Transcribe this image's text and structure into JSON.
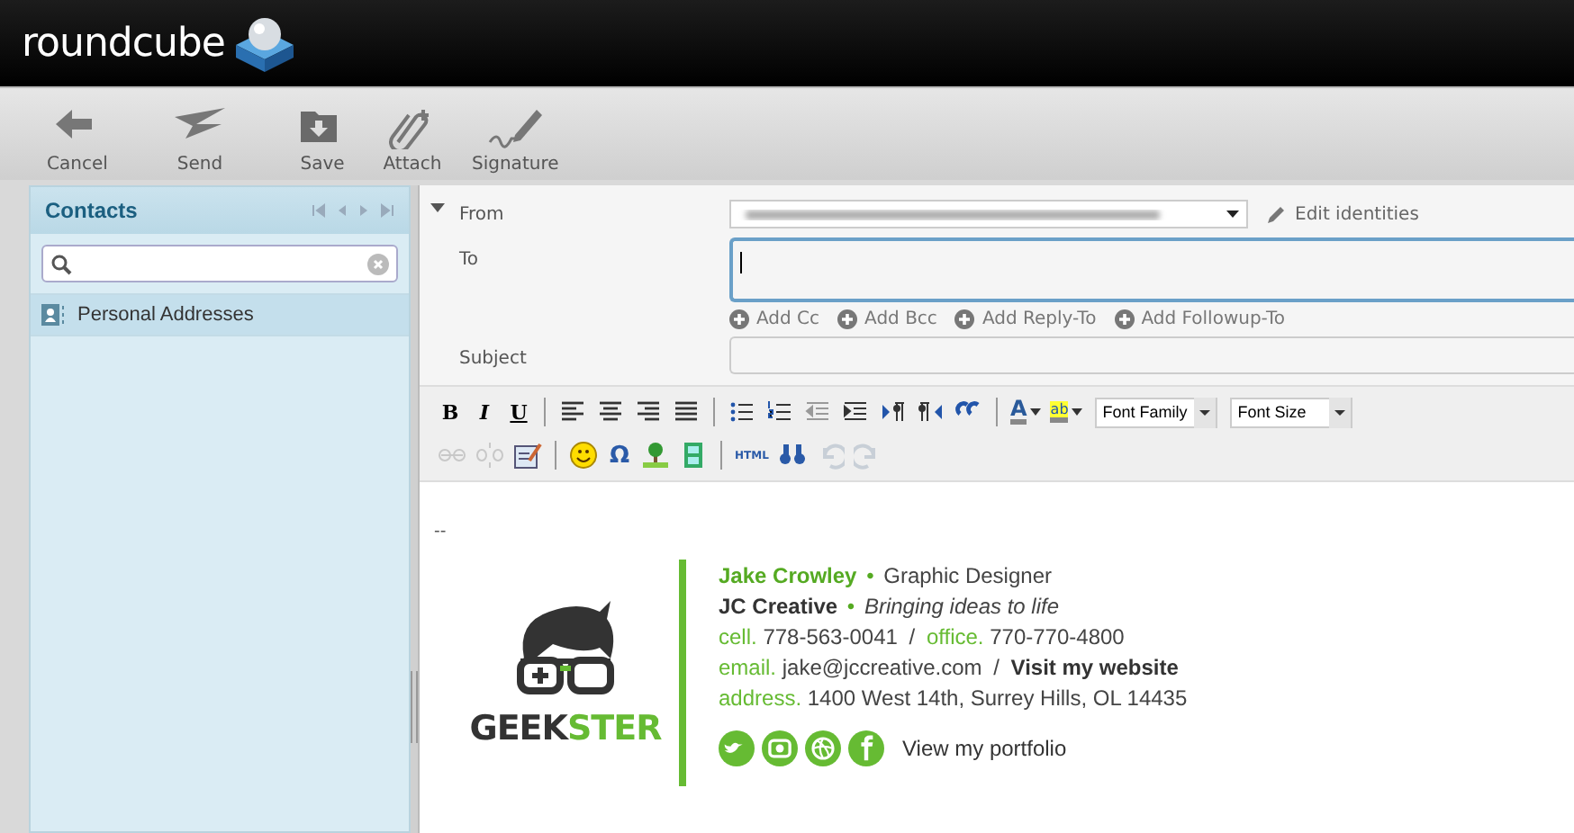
{
  "header": {
    "logo": "roundcube"
  },
  "toolbar": [
    {
      "kind": "cancel",
      "label": "Cancel"
    },
    {
      "kind": "send",
      "label": "Send"
    },
    {
      "kind": "save",
      "label": "Save"
    },
    {
      "kind": "attach",
      "label": "Attach"
    },
    {
      "kind": "signature",
      "label": "Signature"
    }
  ],
  "contacts": {
    "title": "Contacts",
    "address_books": [
      {
        "label": "Personal Addresses",
        "selected": true
      }
    ]
  },
  "compose": {
    "expanded": true,
    "from": {
      "label": "From"
    },
    "edit_identities": "Edit identities",
    "to": {
      "label": "To"
    },
    "add_links": [
      "Add Cc",
      "Add Bcc",
      "Add Reply-To",
      "Add Followup-To"
    ],
    "subject": {
      "label": "Subject"
    }
  },
  "editor": {
    "toolbar_rows": [
      [
        {
          "kind": "bold",
          "label": "B",
          "disabled": false
        },
        {
          "kind": "italic",
          "label": "I",
          "disabled": false
        },
        {
          "kind": "underline",
          "label": "U",
          "disabled": false
        },
        {
          "kind": "sep"
        },
        {
          "kind": "align-left",
          "disabled": false
        },
        {
          "kind": "align-center",
          "disabled": false
        },
        {
          "kind": "align-right",
          "disabled": false
        },
        {
          "kind": "justify",
          "disabled": false
        },
        {
          "kind": "sep"
        },
        {
          "kind": "bullets",
          "disabled": false
        },
        {
          "kind": "numbers",
          "disabled": false
        },
        {
          "kind": "outdent",
          "disabled": true
        },
        {
          "kind": "indent",
          "disabled": false
        },
        {
          "kind": "ltr",
          "disabled": false
        },
        {
          "kind": "rtl",
          "disabled": false
        },
        {
          "kind": "quote",
          "disabled": false
        },
        {
          "kind": "sep"
        },
        {
          "kind": "forecolor",
          "label": "A",
          "disabled": false
        },
        {
          "kind": "backcolor",
          "label": "ab",
          "disabled": false
        },
        {
          "kind": "select",
          "label": "Font Family"
        },
        {
          "kind": "select",
          "label": "Font Size"
        }
      ],
      [
        {
          "kind": "link",
          "disabled": true
        },
        {
          "kind": "unlink",
          "disabled": true
        },
        {
          "kind": "edit",
          "disabled": false
        },
        {
          "kind": "sep"
        },
        {
          "kind": "emoticon",
          "disabled": false
        },
        {
          "kind": "charmap",
          "label": "Ω",
          "disabled": false
        },
        {
          "kind": "image",
          "disabled": false
        },
        {
          "kind": "media",
          "disabled": false
        },
        {
          "kind": "sep"
        },
        {
          "kind": "html",
          "label": "HTML",
          "disabled": false
        },
        {
          "kind": "search",
          "disabled": false
        },
        {
          "kind": "undo",
          "disabled": true
        },
        {
          "kind": "redo",
          "disabled": true
        }
      ]
    ],
    "separator": "--",
    "signature": {
      "brand": [
        "GEEK",
        "STER"
      ],
      "lines": [
        [
          {
            "kind": "name",
            "text": "Jake Crowley"
          },
          {
            "kind": "dot",
            "text": "•"
          },
          {
            "kind": "text",
            "text": "Graphic Designer"
          }
        ],
        [
          {
            "kind": "bold",
            "text": "JC Creative"
          },
          {
            "kind": "dot",
            "text": "•"
          },
          {
            "kind": "italic",
            "text": "Bringing ideas to life"
          }
        ],
        [
          {
            "kind": "label",
            "text": "cell."
          },
          {
            "kind": "text",
            "text": "778-563-0041"
          },
          {
            "kind": "slash",
            "text": "/"
          },
          {
            "kind": "label",
            "text": "office."
          },
          {
            "kind": "text",
            "text": "770-770-4800"
          }
        ],
        [
          {
            "kind": "label",
            "text": "email."
          },
          {
            "kind": "text",
            "text": "jake@jccreative.com"
          },
          {
            "kind": "slash",
            "text": "/"
          },
          {
            "kind": "bold",
            "text": "Visit my website"
          }
        ],
        [
          {
            "kind": "label",
            "text": "address."
          },
          {
            "kind": "text",
            "text": "1400 West 14th, Surrey Hills, OL 14435"
          }
        ]
      ],
      "socials": [
        {
          "kind": "bird"
        },
        {
          "kind": "camera"
        },
        {
          "kind": "ball"
        },
        {
          "kind": "letter-f"
        }
      ],
      "portfolio": "View my portfolio"
    }
  }
}
